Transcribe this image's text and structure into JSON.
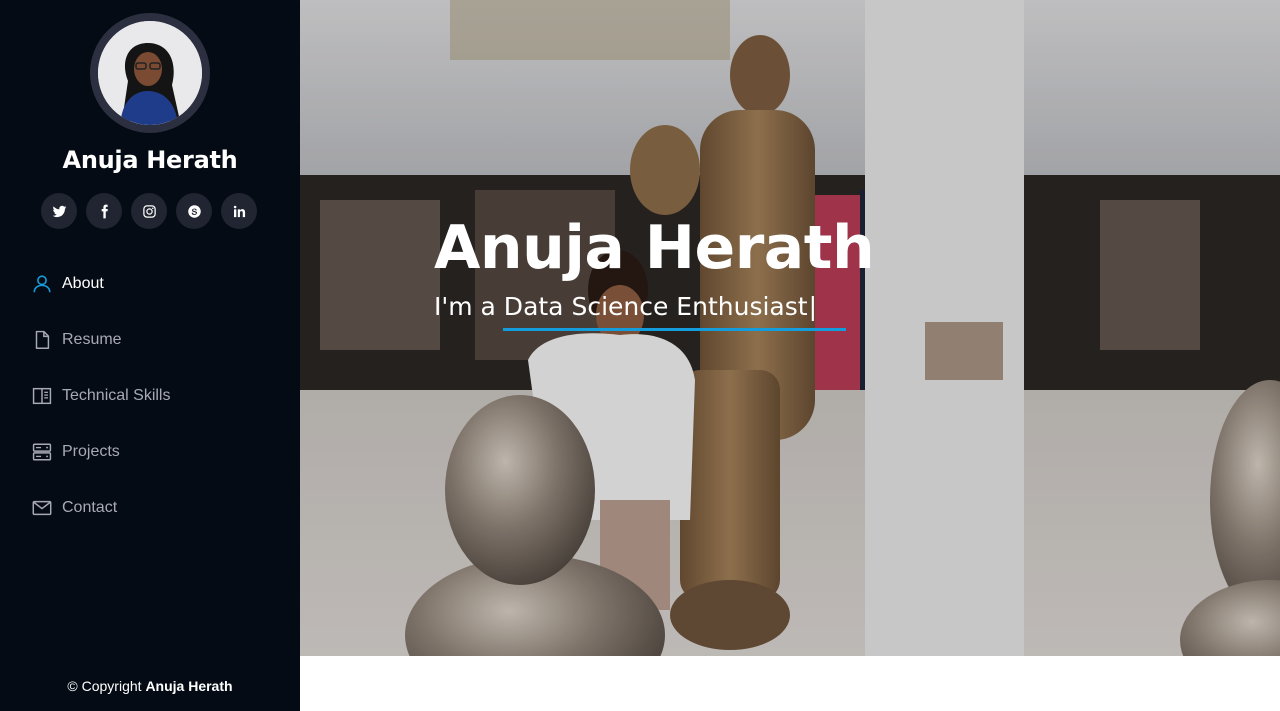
{
  "profile": {
    "name": "Anuja Herath"
  },
  "social": [
    {
      "id": "twitter",
      "icon": "twitter-icon"
    },
    {
      "id": "facebook",
      "icon": "facebook-icon"
    },
    {
      "id": "instagram",
      "icon": "instagram-icon"
    },
    {
      "id": "skype",
      "icon": "skype-icon"
    },
    {
      "id": "linkedin",
      "icon": "linkedin-icon"
    }
  ],
  "nav": {
    "items": [
      {
        "label": "About",
        "icon": "person-icon",
        "active": true
      },
      {
        "label": "Resume",
        "icon": "file-icon",
        "active": false
      },
      {
        "label": "Technical Skills",
        "icon": "layout-icon",
        "active": false
      },
      {
        "label": "Projects",
        "icon": "server-icon",
        "active": false
      },
      {
        "label": "Contact",
        "icon": "envelope-icon",
        "active": false
      }
    ]
  },
  "footer": {
    "copyright_prefix": "© Copyright",
    "copyright_name": "Anuja Herath"
  },
  "hero": {
    "title": "Anuja Herath",
    "subtitle": "I'm a Data Science Enthusiast",
    "cursor": "|"
  },
  "colors": {
    "sidebar_bg": "#040b14",
    "accent": "#149ddd",
    "social_bg": "#212431",
    "nav_text": "#a8a9b4"
  }
}
